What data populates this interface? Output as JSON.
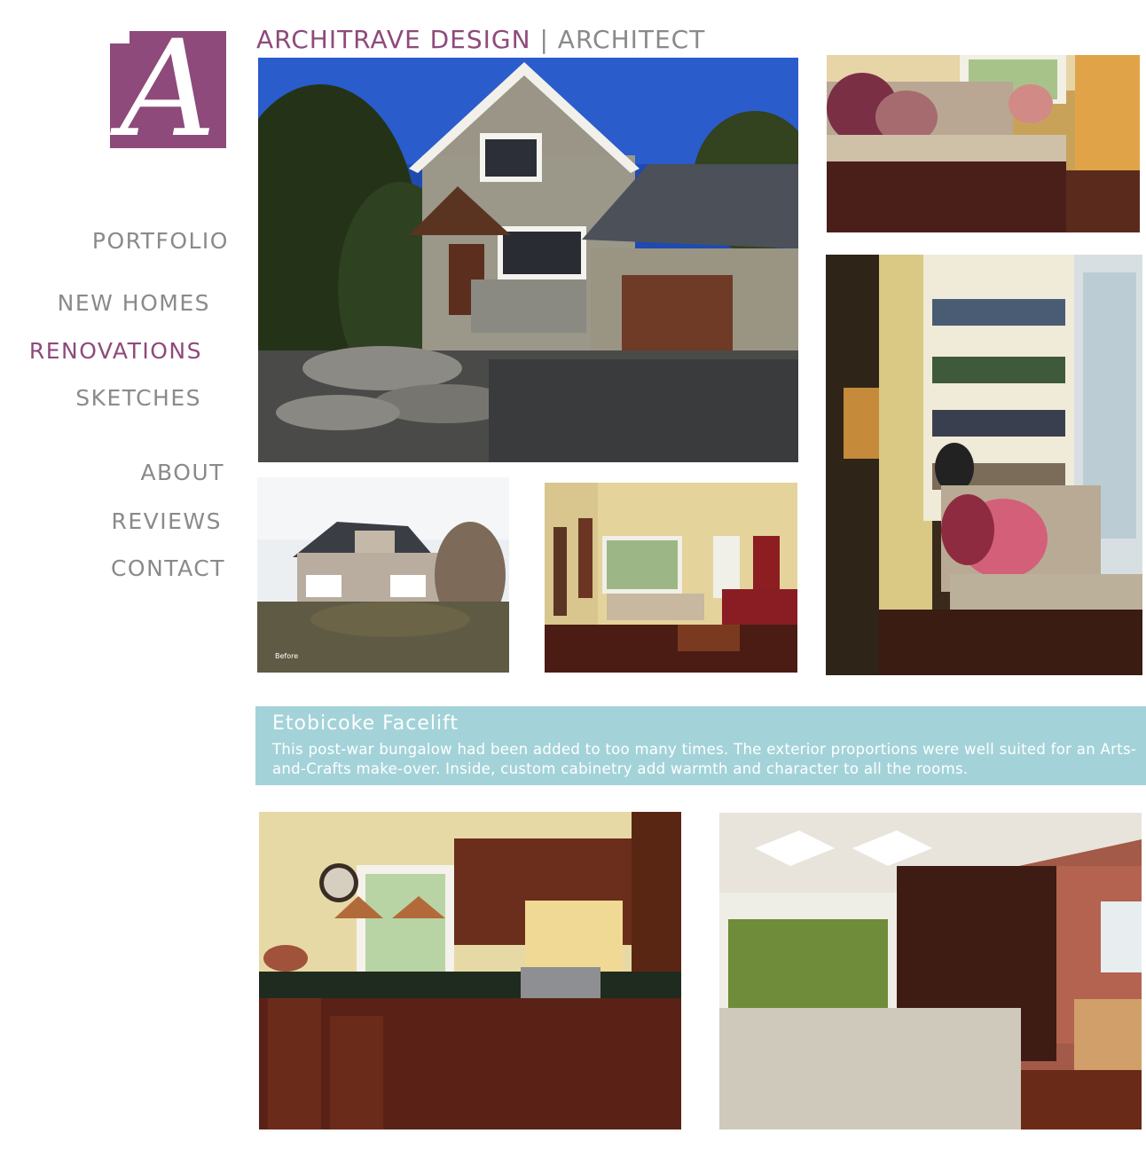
{
  "header": {
    "brand": "ARCHITRAVE DESIGN",
    "separator": "|",
    "role": "ARCHITECT"
  },
  "logo": {
    "letter": "A"
  },
  "colors": {
    "brand": "#8e4a7a",
    "nav_text": "#8a8a8a",
    "info_box": "#a3d3d9"
  },
  "nav": {
    "portfolio": "PORTFOLIO",
    "new_homes": "NEW HOMES",
    "renovations": "RENOVATIONS",
    "sketches": "SKETCHES",
    "about": "ABOUT",
    "reviews": "REVIEWS",
    "contact": "CONTACT",
    "active": "RENOVATIONS"
  },
  "photos": {
    "before_label": "Before"
  },
  "project": {
    "title": "Etobicoke Facelift",
    "description": "This post-war bungalow had been added to too many times. The exterior proportions were well suited for an Arts-and-Crafts make-over. Inside, custom cabinetry add warmth and character to all the rooms."
  }
}
